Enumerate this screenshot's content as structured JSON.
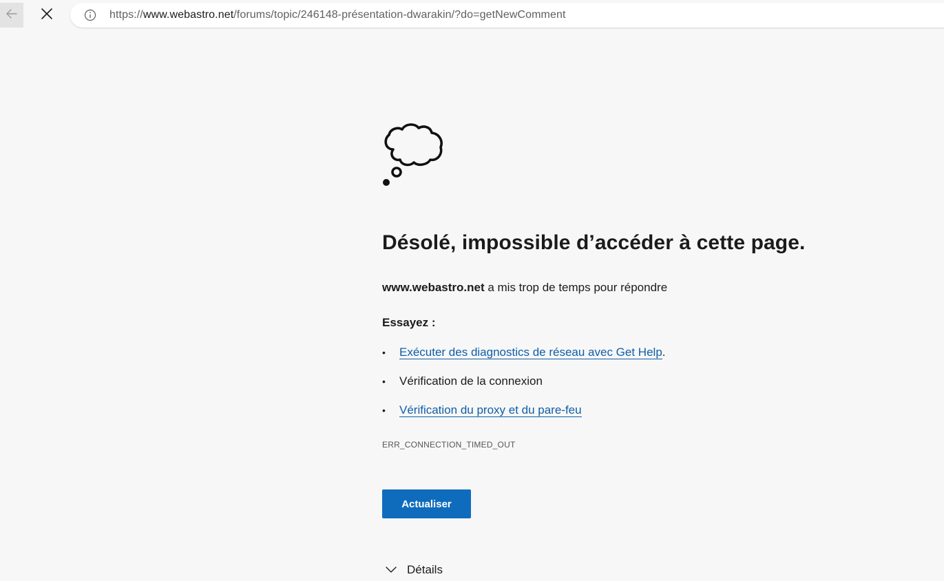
{
  "browser": {
    "url_prefix": "https://",
    "url_host": "www.webastro.net",
    "url_path": "/forums/topic/246148-présentation-dwarakin/?do=getNewComment",
    "icons": {
      "back": "arrow-left-icon",
      "stop": "close-icon",
      "site_info": "info-icon"
    }
  },
  "error_page": {
    "icon": "thought-cloud-icon",
    "title": "Désolé, impossible d’accéder à cette page.",
    "host": "www.webastro.net",
    "subtitle_rest": " a mis trop de temps pour répondre",
    "try_label": "Essayez :",
    "suggestions": [
      {
        "text": "Exécuter des diagnostics de réseau avec Get Help",
        "suffix": ".",
        "is_link": true
      },
      {
        "text": "Vérification de la connexion",
        "suffix": "",
        "is_link": false
      },
      {
        "text": "Vérification du proxy et du pare-feu",
        "suffix": "",
        "is_link": true
      }
    ],
    "error_code": "ERR_CONNECTION_TIMED_OUT",
    "refresh_label": "Actualiser",
    "details_label": "Détails",
    "bullet": "•"
  },
  "colors": {
    "accent": "#0f6cbd",
    "link": "#0f5ea8",
    "background": "#f7f7f7"
  }
}
